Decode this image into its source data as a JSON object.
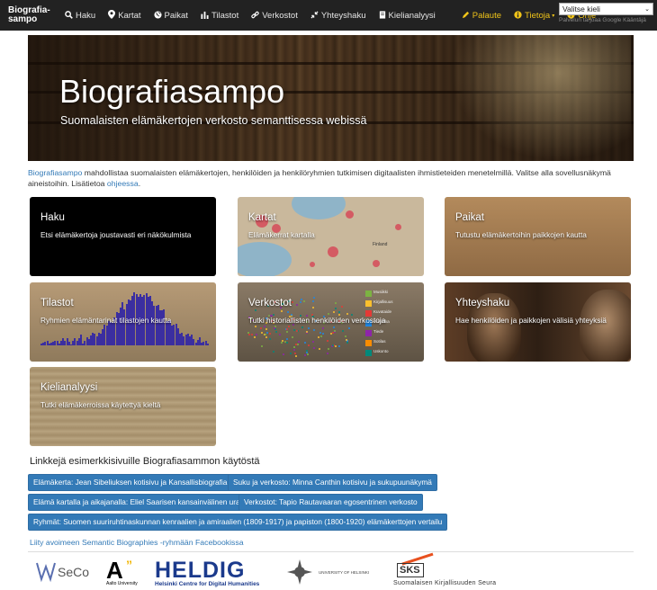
{
  "navbar": {
    "brand": "Biografia-\nsampo",
    "items": [
      {
        "label": "Haku",
        "icon": "search-icon"
      },
      {
        "label": "Kartat",
        "icon": "map-marker-icon"
      },
      {
        "label": "Paikat",
        "icon": "globe-icon"
      },
      {
        "label": "Tilastot",
        "icon": "bar-chart-icon"
      },
      {
        "label": "Verkostot",
        "icon": "link-icon"
      },
      {
        "label": "Yhteyshaku",
        "icon": "compress-icon"
      },
      {
        "label": "Kielianalyysi",
        "icon": "book-icon"
      },
      {
        "label": "Palaute",
        "icon": "pencil-icon"
      },
      {
        "label": "Tietoja",
        "icon": "info-icon"
      },
      {
        "label": "Ohje",
        "icon": "question-icon"
      }
    ],
    "language_select": "Valitse kieli",
    "powered_by": "Palvelun tarjoaa Google Kääntäjä",
    "accent_color": "#f0c419"
  },
  "hero": {
    "title": "Biografiasampo",
    "subtitle": "Suomalaisten elämäkertojen verkosto semanttisessa webissä"
  },
  "intro": {
    "brand_link": "Biografiasampo",
    "text": " mahdollistaa suomalaisten elämäkertojen, henkilöiden ja henkilöryhmien tutkimisen digitaalisten ihmistieteiden menetelmillä. Valitse alla sovellusnäkymä aineistoihin. Lisätietoa ",
    "help_link": "ohjeessa",
    "end": "."
  },
  "tiles": [
    {
      "title": "Haku",
      "desc": "Etsi elämäkertoja joustavasti eri näkökulmista"
    },
    {
      "title": "Kartat",
      "desc": "Elämäkerrat kartalla"
    },
    {
      "title": "Paikat",
      "desc": "Tutustu elämäkertoihin paikkojen kautta"
    },
    {
      "title": "Tilastot",
      "desc": "Ryhmien elämäntarinat tilastojen kautta"
    },
    {
      "title": "Verkostot",
      "desc": "Tutki historiallisten henkilöiden verkostoja"
    },
    {
      "title": "Yhteyshaku",
      "desc": "Hae henkilöiden ja paikkojen välisiä yhteyksiä"
    },
    {
      "title": "Kielianalyysi",
      "desc": "Tutki elämäkerroissa käytettyä kieltä"
    }
  ],
  "network_legend": [
    "Musiikki",
    "Kirjallisuus",
    "Kuvataide",
    "Politiikka",
    "Tiede",
    "Sotilas",
    "Uskonto"
  ],
  "map_label": "Finland",
  "examples": {
    "heading": "Linkkejä esimerkkisivuille Biografiasammon käytöstä",
    "buttons": [
      "Elämäkerta: Jean Sibeliuksen kotisivu ja Kansallisbiografia",
      "Suku ja verkosto: Minna Canthin kotisivu ja sukupuunäkymä",
      "Elämä kartalla ja aikajanalla: Eliel Saarisen kansainvälinen ura",
      "Verkostot: Tapio Rautavaaran egosentrinen verkosto",
      "Ryhmät: Suomen suuriruhtinaskunnan kenraalien ja amiraalien (1809-1917) ja papiston (1800-1920) elämäkerttojen vertailu"
    ],
    "button_color": "#337ab7",
    "facebook_link": "Liity avoimeen Semantic Biographies -ryhmään Facebookissa"
  },
  "logos": {
    "seco": "SeCo",
    "aalto_letter": "A",
    "aalto_quote": "”",
    "aalto": "Aalto University",
    "heldig": "HELDIG",
    "heldig_sub": "Helsinki Centre for Digital Humanities",
    "uh": "UNIVERSITY OF HELSINKI",
    "sks_abbr": "SKS",
    "sks": "Suomalaisen Kirjallisuuden Seura"
  }
}
